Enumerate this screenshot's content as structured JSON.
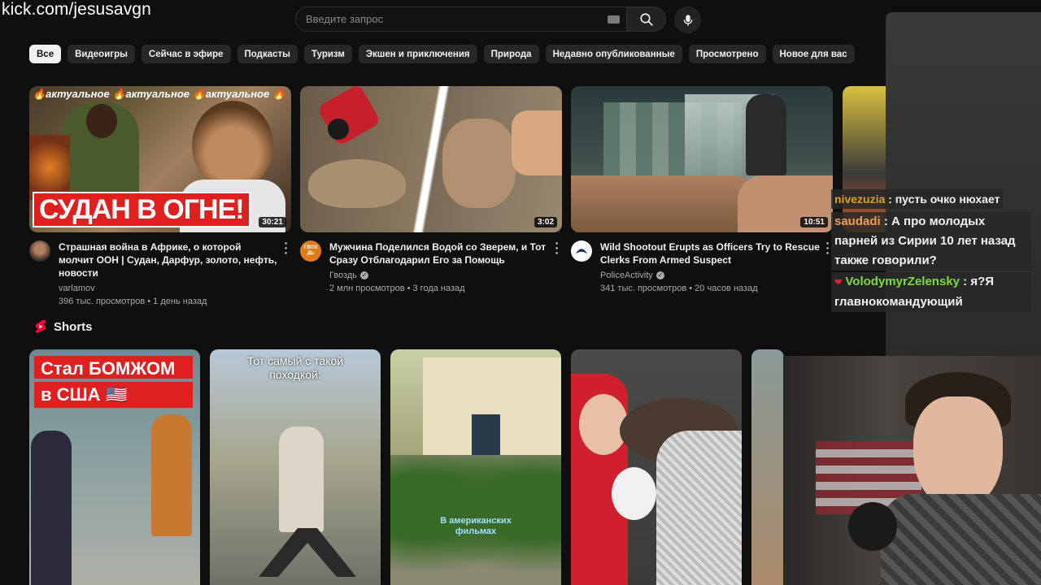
{
  "watermark": "kick.com/jesusavgn",
  "search": {
    "placeholder": "Введите запрос"
  },
  "chips": [
    "Все",
    "Видеоигры",
    "Сейчас в эфире",
    "Подкасты",
    "Туризм",
    "Экшен и приключения",
    "Природа",
    "Недавно опубликованные",
    "Просмотрено",
    "Новое для вас"
  ],
  "videos": [
    {
      "title": "Страшная война в Африке, о которой молчит ООН | Судан, Дарфур, золото, нефть, новости",
      "channel": "varlamov",
      "verified": true,
      "stats": "396 тыс. просмотров • 1 день назад",
      "duration": "30:21",
      "thumb_caption": "СУДАН В ОГНЕ!",
      "thumb_banner": "🔥актуальное 🔥актуальное 🔥актуальное 🔥"
    },
    {
      "title": "Мужчина Поделился Водой со Зверем, и Тот Сразу Отблагодарил Его за Помощь",
      "channel": "Гвоздь",
      "verified": true,
      "stats": "2 млн просмотров • 3 года назад",
      "duration": "3:02",
      "avatar_text": "ГВОЗДЬ"
    },
    {
      "title": "Wild Shootout Erupts as Officers Try to Rescue Clerks From Armed Suspect",
      "channel": "PoliceActivity",
      "verified": true,
      "stats": "341 тыс. просмотров • 20 часов назад",
      "duration": "10:51"
    }
  ],
  "shorts": {
    "label": "Shorts",
    "items": [
      {
        "caption": "Стал БОМЖОМ в США 🇺🇸"
      },
      {
        "caption": "Тот самый с такой походкой:"
      },
      {
        "caption": "В американских фильмах"
      },
      {
        "caption": ""
      },
      {
        "caption": ""
      }
    ]
  },
  "chat": [
    {
      "user": "nivezuzia",
      "text": "пусть очко нюхает",
      "color": "#d9a21b"
    },
    {
      "user": "saudadi",
      "text": "А про молодых парней из Сирии 10 лет назад также говорили?",
      "color": "#e8a05a"
    },
    {
      "user": "VolodymyrZelensky",
      "text": "я?Я главнокомандующий",
      "color": "#7ddc3c"
    }
  ],
  "colors": {
    "background": "#0f0f0f",
    "chip_bg": "#272727",
    "chip_active_bg": "#f1f1f1",
    "text_secondary": "#aaaaaa"
  }
}
